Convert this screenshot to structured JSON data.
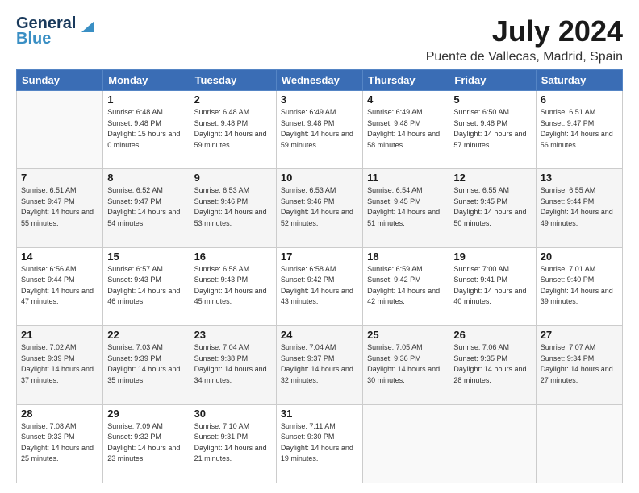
{
  "header": {
    "logo_line1": "General",
    "logo_line2": "Blue",
    "title": "July 2024",
    "subtitle": "Puente de Vallecas, Madrid, Spain"
  },
  "weekdays": [
    "Sunday",
    "Monday",
    "Tuesday",
    "Wednesday",
    "Thursday",
    "Friday",
    "Saturday"
  ],
  "weeks": [
    [
      {
        "day": "",
        "sunrise": "",
        "sunset": "",
        "daylight": ""
      },
      {
        "day": "1",
        "sunrise": "Sunrise: 6:48 AM",
        "sunset": "Sunset: 9:48 PM",
        "daylight": "Daylight: 15 hours and 0 minutes."
      },
      {
        "day": "2",
        "sunrise": "Sunrise: 6:48 AM",
        "sunset": "Sunset: 9:48 PM",
        "daylight": "Daylight: 14 hours and 59 minutes."
      },
      {
        "day": "3",
        "sunrise": "Sunrise: 6:49 AM",
        "sunset": "Sunset: 9:48 PM",
        "daylight": "Daylight: 14 hours and 59 minutes."
      },
      {
        "day": "4",
        "sunrise": "Sunrise: 6:49 AM",
        "sunset": "Sunset: 9:48 PM",
        "daylight": "Daylight: 14 hours and 58 minutes."
      },
      {
        "day": "5",
        "sunrise": "Sunrise: 6:50 AM",
        "sunset": "Sunset: 9:48 PM",
        "daylight": "Daylight: 14 hours and 57 minutes."
      },
      {
        "day": "6",
        "sunrise": "Sunrise: 6:51 AM",
        "sunset": "Sunset: 9:47 PM",
        "daylight": "Daylight: 14 hours and 56 minutes."
      }
    ],
    [
      {
        "day": "7",
        "sunrise": "Sunrise: 6:51 AM",
        "sunset": "Sunset: 9:47 PM",
        "daylight": "Daylight: 14 hours and 55 minutes."
      },
      {
        "day": "8",
        "sunrise": "Sunrise: 6:52 AM",
        "sunset": "Sunset: 9:47 PM",
        "daylight": "Daylight: 14 hours and 54 minutes."
      },
      {
        "day": "9",
        "sunrise": "Sunrise: 6:53 AM",
        "sunset": "Sunset: 9:46 PM",
        "daylight": "Daylight: 14 hours and 53 minutes."
      },
      {
        "day": "10",
        "sunrise": "Sunrise: 6:53 AM",
        "sunset": "Sunset: 9:46 PM",
        "daylight": "Daylight: 14 hours and 52 minutes."
      },
      {
        "day": "11",
        "sunrise": "Sunrise: 6:54 AM",
        "sunset": "Sunset: 9:45 PM",
        "daylight": "Daylight: 14 hours and 51 minutes."
      },
      {
        "day": "12",
        "sunrise": "Sunrise: 6:55 AM",
        "sunset": "Sunset: 9:45 PM",
        "daylight": "Daylight: 14 hours and 50 minutes."
      },
      {
        "day": "13",
        "sunrise": "Sunrise: 6:55 AM",
        "sunset": "Sunset: 9:44 PM",
        "daylight": "Daylight: 14 hours and 49 minutes."
      }
    ],
    [
      {
        "day": "14",
        "sunrise": "Sunrise: 6:56 AM",
        "sunset": "Sunset: 9:44 PM",
        "daylight": "Daylight: 14 hours and 47 minutes."
      },
      {
        "day": "15",
        "sunrise": "Sunrise: 6:57 AM",
        "sunset": "Sunset: 9:43 PM",
        "daylight": "Daylight: 14 hours and 46 minutes."
      },
      {
        "day": "16",
        "sunrise": "Sunrise: 6:58 AM",
        "sunset": "Sunset: 9:43 PM",
        "daylight": "Daylight: 14 hours and 45 minutes."
      },
      {
        "day": "17",
        "sunrise": "Sunrise: 6:58 AM",
        "sunset": "Sunset: 9:42 PM",
        "daylight": "Daylight: 14 hours and 43 minutes."
      },
      {
        "day": "18",
        "sunrise": "Sunrise: 6:59 AM",
        "sunset": "Sunset: 9:42 PM",
        "daylight": "Daylight: 14 hours and 42 minutes."
      },
      {
        "day": "19",
        "sunrise": "Sunrise: 7:00 AM",
        "sunset": "Sunset: 9:41 PM",
        "daylight": "Daylight: 14 hours and 40 minutes."
      },
      {
        "day": "20",
        "sunrise": "Sunrise: 7:01 AM",
        "sunset": "Sunset: 9:40 PM",
        "daylight": "Daylight: 14 hours and 39 minutes."
      }
    ],
    [
      {
        "day": "21",
        "sunrise": "Sunrise: 7:02 AM",
        "sunset": "Sunset: 9:39 PM",
        "daylight": "Daylight: 14 hours and 37 minutes."
      },
      {
        "day": "22",
        "sunrise": "Sunrise: 7:03 AM",
        "sunset": "Sunset: 9:39 PM",
        "daylight": "Daylight: 14 hours and 35 minutes."
      },
      {
        "day": "23",
        "sunrise": "Sunrise: 7:04 AM",
        "sunset": "Sunset: 9:38 PM",
        "daylight": "Daylight: 14 hours and 34 minutes."
      },
      {
        "day": "24",
        "sunrise": "Sunrise: 7:04 AM",
        "sunset": "Sunset: 9:37 PM",
        "daylight": "Daylight: 14 hours and 32 minutes."
      },
      {
        "day": "25",
        "sunrise": "Sunrise: 7:05 AM",
        "sunset": "Sunset: 9:36 PM",
        "daylight": "Daylight: 14 hours and 30 minutes."
      },
      {
        "day": "26",
        "sunrise": "Sunrise: 7:06 AM",
        "sunset": "Sunset: 9:35 PM",
        "daylight": "Daylight: 14 hours and 28 minutes."
      },
      {
        "day": "27",
        "sunrise": "Sunrise: 7:07 AM",
        "sunset": "Sunset: 9:34 PM",
        "daylight": "Daylight: 14 hours and 27 minutes."
      }
    ],
    [
      {
        "day": "28",
        "sunrise": "Sunrise: 7:08 AM",
        "sunset": "Sunset: 9:33 PM",
        "daylight": "Daylight: 14 hours and 25 minutes."
      },
      {
        "day": "29",
        "sunrise": "Sunrise: 7:09 AM",
        "sunset": "Sunset: 9:32 PM",
        "daylight": "Daylight: 14 hours and 23 minutes."
      },
      {
        "day": "30",
        "sunrise": "Sunrise: 7:10 AM",
        "sunset": "Sunset: 9:31 PM",
        "daylight": "Daylight: 14 hours and 21 minutes."
      },
      {
        "day": "31",
        "sunrise": "Sunrise: 7:11 AM",
        "sunset": "Sunset: 9:30 PM",
        "daylight": "Daylight: 14 hours and 19 minutes."
      },
      {
        "day": "",
        "sunrise": "",
        "sunset": "",
        "daylight": ""
      },
      {
        "day": "",
        "sunrise": "",
        "sunset": "",
        "daylight": ""
      },
      {
        "day": "",
        "sunrise": "",
        "sunset": "",
        "daylight": ""
      }
    ]
  ]
}
